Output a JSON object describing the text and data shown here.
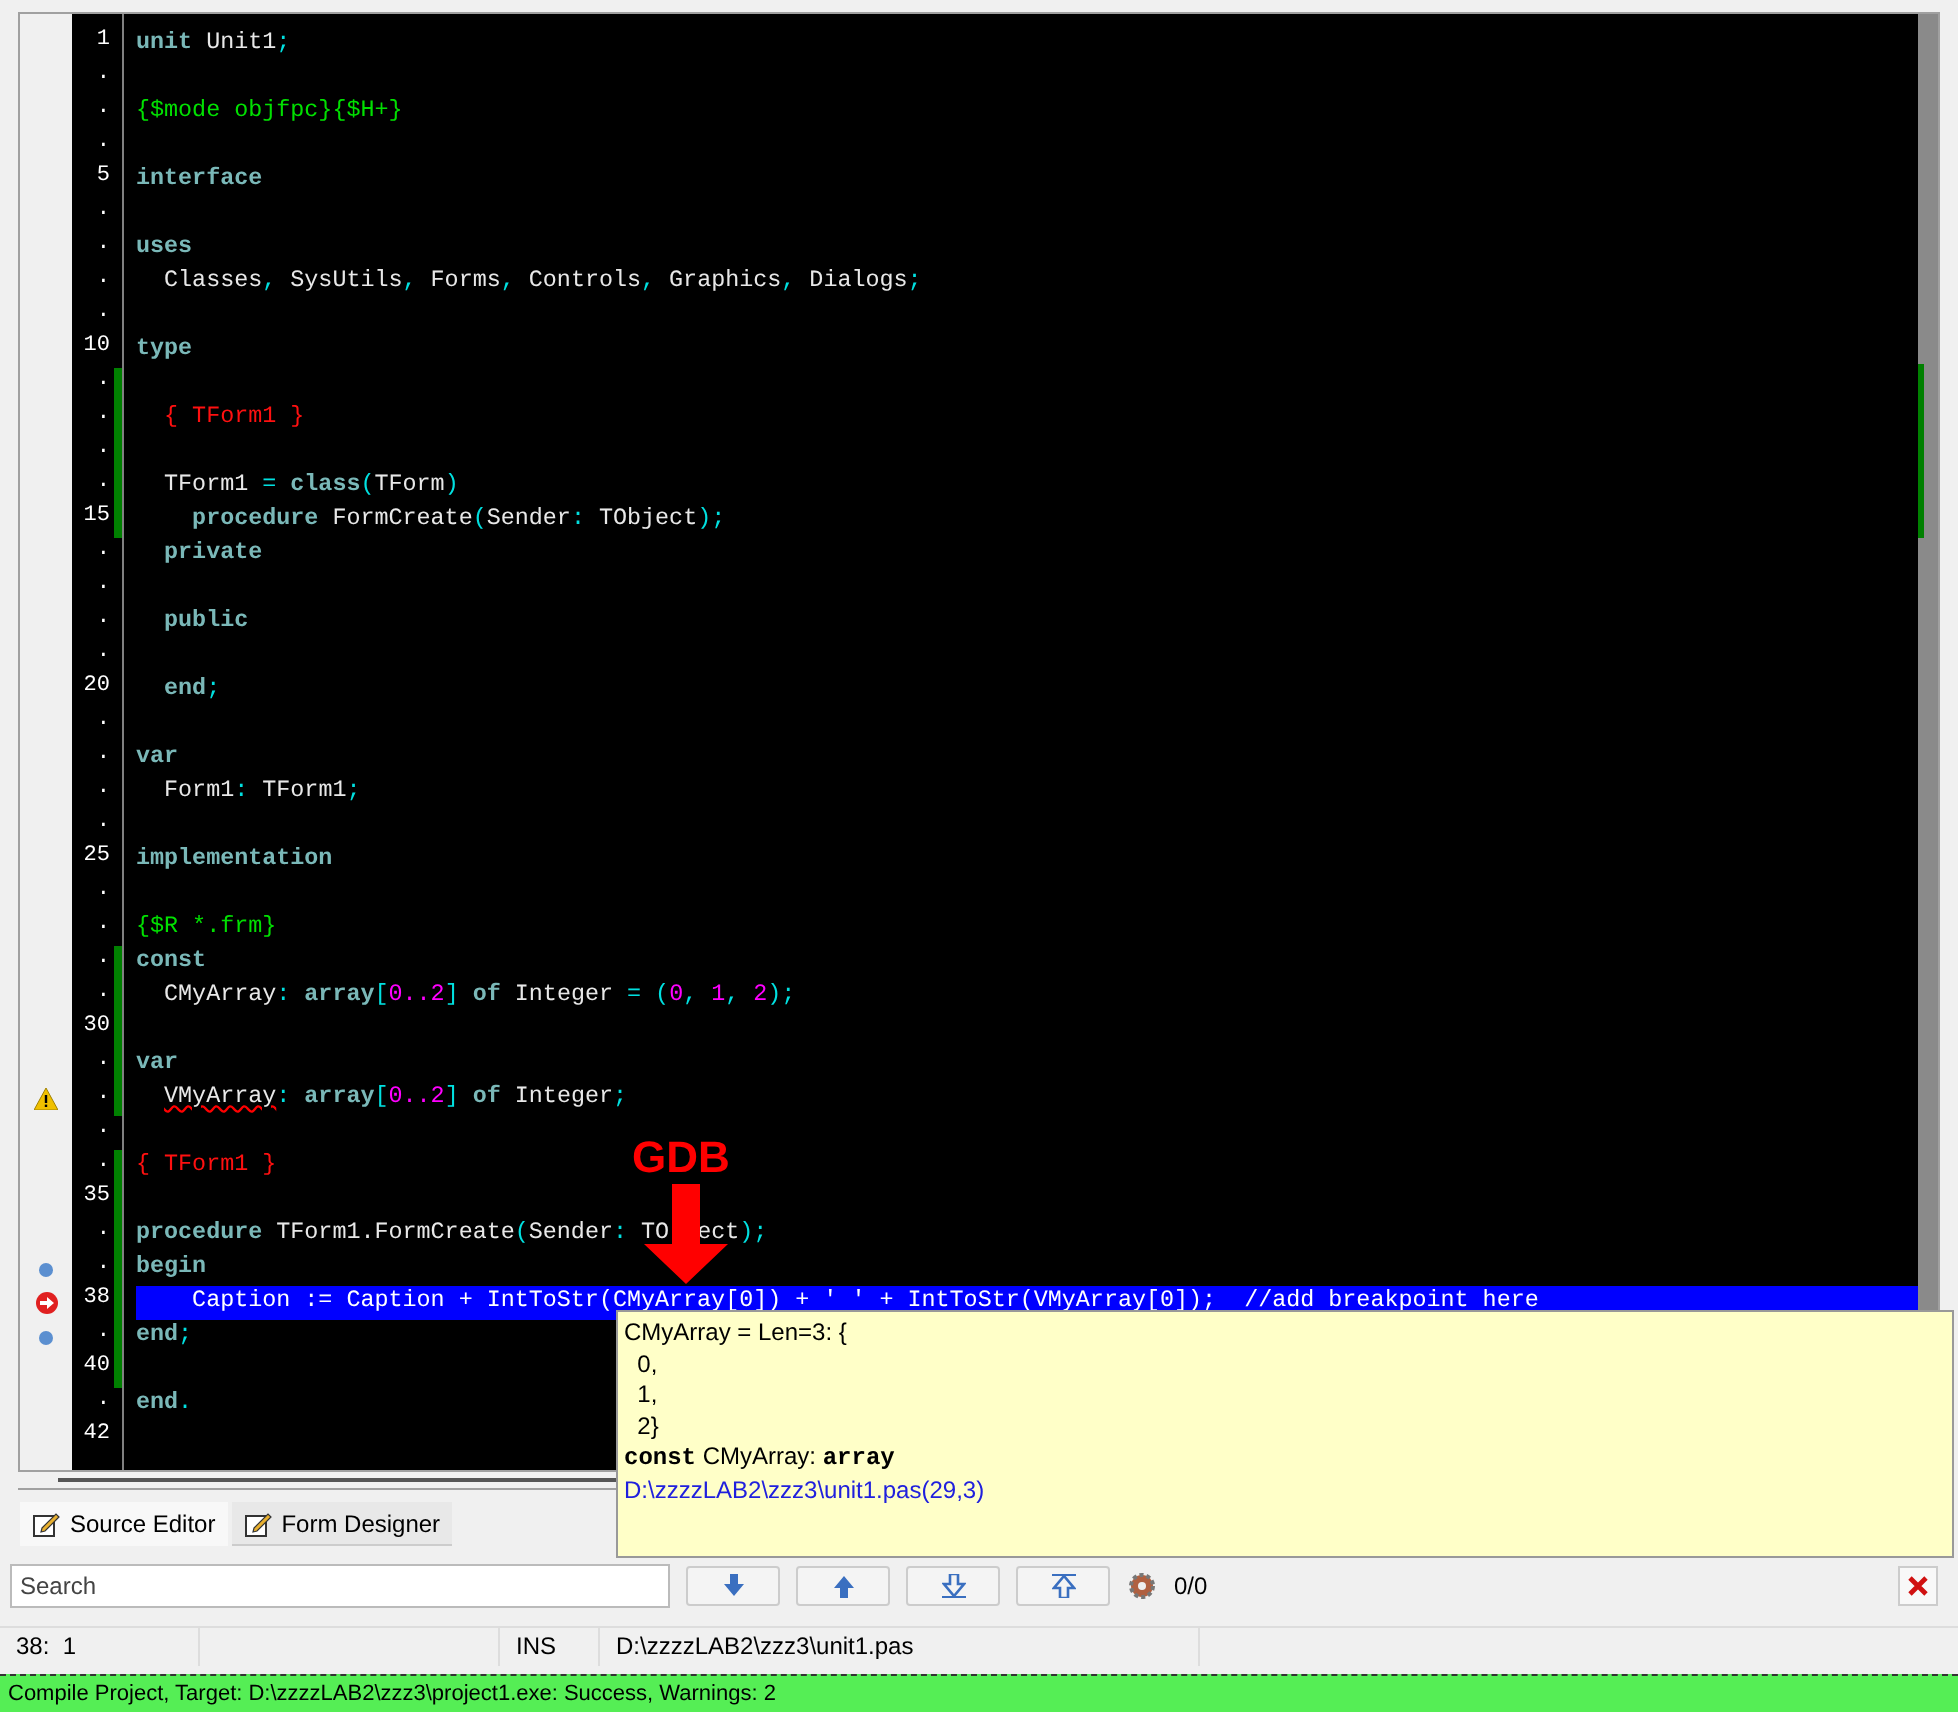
{
  "editor": {
    "lines": [
      {
        "gutter": "1",
        "kind": "plain",
        "modified": false,
        "current": false,
        "tokens": [
          {
            "kind": "keyword",
            "text": "unit"
          },
          {
            "kind": "ident",
            "text": " Unit1"
          },
          {
            "kind": "symbol",
            "text": ";"
          }
        ]
      },
      {
        "gutter": ".",
        "kind": "plain",
        "modified": false,
        "current": false
      },
      {
        "gutter": ".",
        "kind": "plain",
        "modified": false,
        "current": false,
        "tokens": [
          {
            "kind": "directive",
            "text": "{$mode objfpc}{$H+}"
          }
        ]
      },
      {
        "gutter": ".",
        "kind": "plain",
        "modified": false,
        "current": false
      },
      {
        "gutter": "5",
        "kind": "plain",
        "modified": false,
        "current": false,
        "tokens": [
          {
            "kind": "keyword",
            "text": "interface"
          }
        ]
      },
      {
        "gutter": ".",
        "kind": "plain",
        "modified": false,
        "current": false
      },
      {
        "gutter": ".",
        "kind": "plain",
        "modified": false,
        "current": false,
        "tokens": [
          {
            "kind": "keyword",
            "text": "uses"
          }
        ]
      },
      {
        "gutter": ".",
        "kind": "plain",
        "modified": false,
        "current": false,
        "tokens": [
          {
            "kind": "ident",
            "text": "  Classes"
          },
          {
            "kind": "symbol",
            "text": ","
          },
          {
            "kind": "ident",
            "text": " SysUtils"
          },
          {
            "kind": "symbol",
            "text": ","
          },
          {
            "kind": "ident",
            "text": " Forms"
          },
          {
            "kind": "symbol",
            "text": ","
          },
          {
            "kind": "ident",
            "text": " Controls"
          },
          {
            "kind": "symbol",
            "text": ","
          },
          {
            "kind": "ident",
            "text": " Graphics"
          },
          {
            "kind": "symbol",
            "text": ","
          },
          {
            "kind": "ident",
            "text": " Dialogs"
          },
          {
            "kind": "symbol",
            "text": ";"
          }
        ]
      },
      {
        "gutter": ".",
        "kind": "plain",
        "modified": false,
        "current": false
      },
      {
        "gutter": "10",
        "kind": "plain",
        "modified": false,
        "current": false,
        "tokens": [
          {
            "kind": "keyword",
            "text": "type"
          }
        ]
      },
      {
        "gutter": ".",
        "kind": "plain",
        "modified": true,
        "current": false
      },
      {
        "gutter": ".",
        "kind": "plain",
        "modified": true,
        "current": false,
        "tokens": [
          {
            "kind": "comment",
            "text": "  { TForm1 }"
          }
        ]
      },
      {
        "gutter": ".",
        "kind": "plain",
        "modified": true,
        "current": false
      },
      {
        "gutter": ".",
        "kind": "plain",
        "modified": true,
        "current": false,
        "tokens": [
          {
            "kind": "ident",
            "text": "  TForm1 "
          },
          {
            "kind": "symbol",
            "text": "="
          },
          {
            "kind": "keyword",
            "text": " class"
          },
          {
            "kind": "symbol",
            "text": "("
          },
          {
            "kind": "ident",
            "text": "TForm"
          },
          {
            "kind": "symbol",
            "text": ")"
          }
        ]
      },
      {
        "gutter": "15",
        "kind": "plain",
        "modified": true,
        "current": false,
        "tokens": [
          {
            "kind": "keyword",
            "text": "    procedure"
          },
          {
            "kind": "ident",
            "text": " FormCreate"
          },
          {
            "kind": "symbol",
            "text": "("
          },
          {
            "kind": "ident",
            "text": "Sender"
          },
          {
            "kind": "symbol",
            "text": ":"
          },
          {
            "kind": "ident",
            "text": " TObject"
          },
          {
            "kind": "symbol",
            "text": ");"
          }
        ]
      },
      {
        "gutter": ".",
        "kind": "plain",
        "modified": false,
        "current": false,
        "tokens": [
          {
            "kind": "keyword",
            "text": "  private"
          }
        ]
      },
      {
        "gutter": ".",
        "kind": "plain",
        "modified": false,
        "current": false
      },
      {
        "gutter": ".",
        "kind": "plain",
        "modified": false,
        "current": false,
        "tokens": [
          {
            "kind": "keyword",
            "text": "  public"
          }
        ]
      },
      {
        "gutter": ".",
        "kind": "plain",
        "modified": false,
        "current": false
      },
      {
        "gutter": "20",
        "kind": "plain",
        "modified": false,
        "current": false,
        "tokens": [
          {
            "kind": "keyword",
            "text": "  end"
          },
          {
            "kind": "symbol",
            "text": ";"
          }
        ]
      },
      {
        "gutter": ".",
        "kind": "plain",
        "modified": false,
        "current": false
      },
      {
        "gutter": ".",
        "kind": "plain",
        "modified": false,
        "current": false,
        "tokens": [
          {
            "kind": "keyword",
            "text": "var"
          }
        ]
      },
      {
        "gutter": ".",
        "kind": "plain",
        "modified": false,
        "current": false,
        "tokens": [
          {
            "kind": "ident",
            "text": "  Form1"
          },
          {
            "kind": "symbol",
            "text": ":"
          },
          {
            "kind": "ident",
            "text": " TForm1"
          },
          {
            "kind": "symbol",
            "text": ";"
          }
        ]
      },
      {
        "gutter": ".",
        "kind": "plain",
        "modified": false,
        "current": false
      },
      {
        "gutter": "25",
        "kind": "plain",
        "modified": false,
        "current": false,
        "tokens": [
          {
            "kind": "keyword",
            "text": "implementation"
          }
        ]
      },
      {
        "gutter": ".",
        "kind": "plain",
        "modified": false,
        "current": false
      },
      {
        "gutter": ".",
        "kind": "plain",
        "modified": false,
        "current": false,
        "tokens": [
          {
            "kind": "directive",
            "text": "{$R *.frm}"
          }
        ]
      },
      {
        "gutter": ".",
        "kind": "plain",
        "modified": true,
        "current": false,
        "tokens": [
          {
            "kind": "keyword",
            "text": "const"
          }
        ]
      },
      {
        "gutter": ".",
        "kind": "plain",
        "modified": true,
        "current": false,
        "tokens": [
          {
            "kind": "ident",
            "text": "  CMyArray"
          },
          {
            "kind": "symbol",
            "text": ":"
          },
          {
            "kind": "keyword",
            "text": " array"
          },
          {
            "kind": "symbol",
            "text": "["
          },
          {
            "kind": "number",
            "text": "0..2"
          },
          {
            "kind": "symbol",
            "text": "]"
          },
          {
            "kind": "keyword",
            "text": " of"
          },
          {
            "kind": "ident",
            "text": " Integer "
          },
          {
            "kind": "symbol",
            "text": "= ("
          },
          {
            "kind": "number",
            "text": "0"
          },
          {
            "kind": "symbol",
            "text": ", "
          },
          {
            "kind": "number",
            "text": "1"
          },
          {
            "kind": "symbol",
            "text": ", "
          },
          {
            "kind": "number",
            "text": "2"
          },
          {
            "kind": "symbol",
            "text": ");"
          }
        ]
      },
      {
        "gutter": "30",
        "kind": "plain",
        "modified": true,
        "current": false
      },
      {
        "gutter": ".",
        "kind": "plain",
        "modified": true,
        "current": false,
        "tokens": [
          {
            "kind": "keyword",
            "text": "var"
          }
        ]
      },
      {
        "gutter": ".",
        "kind": "warning",
        "modified": true,
        "current": false,
        "tokens": [
          {
            "kind": "error",
            "text": "  VMyArray"
          },
          {
            "kind": "symbol",
            "text": ":"
          },
          {
            "kind": "keyword",
            "text": " array"
          },
          {
            "kind": "symbol",
            "text": "["
          },
          {
            "kind": "number",
            "text": "0..2"
          },
          {
            "kind": "symbol",
            "text": "]"
          },
          {
            "kind": "keyword",
            "text": " of"
          },
          {
            "kind": "ident",
            "text": " Integer"
          },
          {
            "kind": "symbol",
            "text": ";"
          }
        ]
      },
      {
        "gutter": ".",
        "kind": "plain",
        "modified": false,
        "current": false
      },
      {
        "gutter": ".",
        "kind": "plain",
        "modified": true,
        "current": false,
        "tokens": [
          {
            "kind": "comment",
            "text": "{ TForm1 }"
          }
        ]
      },
      {
        "gutter": "35",
        "kind": "plain",
        "modified": true,
        "current": false
      },
      {
        "gutter": ".",
        "kind": "plain",
        "modified": true,
        "current": false,
        "tokens": [
          {
            "kind": "keyword",
            "text": "procedure"
          },
          {
            "kind": "ident",
            "text": " TForm1.FormCreate"
          },
          {
            "kind": "symbol",
            "text": "("
          },
          {
            "kind": "ident",
            "text": "Sender"
          },
          {
            "kind": "symbol",
            "text": ":"
          },
          {
            "kind": "ident",
            "text": " TO"
          },
          {
            "kind": "ident",
            "text": "  ect"
          },
          {
            "kind": "symbol",
            "text": ");"
          }
        ]
      },
      {
        "gutter": ".",
        "kind": "dot",
        "modified": true,
        "current": false,
        "tokens": [
          {
            "kind": "keyword",
            "text": "begin"
          }
        ]
      },
      {
        "gutter": "38",
        "kind": "breakpoint",
        "modified": true,
        "current": true,
        "tokens": [
          {
            "kind": "ident",
            "text": "    Caption := Caption + IntToStr(CMyArray[0]) + ' ' + IntToStr(VMyArray[0]);  //add breakpoint here"
          }
        ]
      },
      {
        "gutter": ".",
        "kind": "dot",
        "modified": true,
        "current": false,
        "tokens": [
          {
            "kind": "keyword",
            "text": "end"
          },
          {
            "kind": "symbol",
            "text": ";"
          }
        ]
      },
      {
        "gutter": "40",
        "kind": "plain",
        "modified": true,
        "current": false
      },
      {
        "gutter": ".",
        "kind": "plain",
        "modified": false,
        "current": false,
        "tokens": [
          {
            "kind": "keyword",
            "text": "end"
          },
          {
            "kind": "symbol",
            "text": "."
          }
        ]
      },
      {
        "gutter": "42",
        "kind": "plain",
        "modified": false,
        "current": false
      }
    ]
  },
  "annotation": {
    "label": "GDB"
  },
  "hint": {
    "lines": [
      "CMyArray = Len=3: {",
      "  0,",
      "  1,",
      "  2}"
    ],
    "declaration": "**const** CMyArray: **array**",
    "location": "D:\\zzzzLAB2\\zzz3\\unit1.pas(29,3)"
  },
  "tabs": [
    {
      "label": "Source Editor",
      "selected": true
    },
    {
      "label": "Form Designer",
      "selected": false
    }
  ],
  "search": {
    "placeholder": "Search",
    "count": "0/0"
  },
  "status_bar": {
    "position": "38:  1",
    "mode": "INS",
    "file": "D:\\zzzzLAB2\\zzz3\\unit1.pas"
  },
  "messages": {
    "text": "Compile Project, Target: D:\\zzzzLAB2\\zzz3\\project1.exe: Success, Warnings: 2"
  }
}
